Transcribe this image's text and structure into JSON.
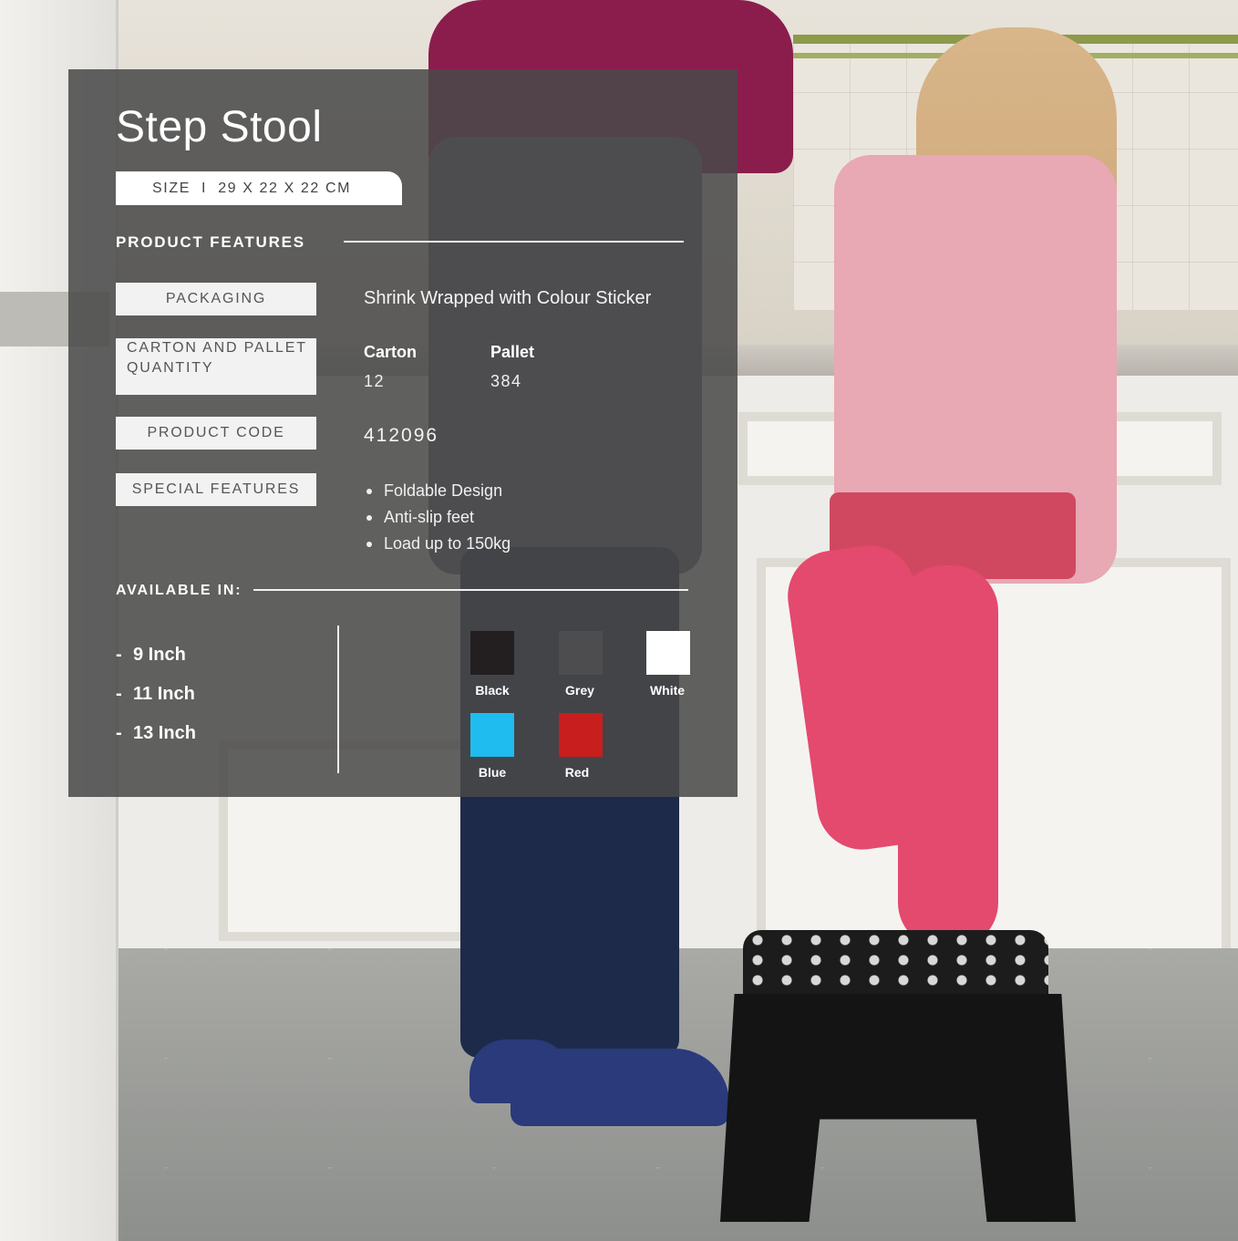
{
  "product": {
    "title": "Step Stool",
    "size": "SIZE  I  29 X 22 X 22 CM"
  },
  "features": {
    "heading": "PRODUCT FEATURES",
    "packaging_label": "PACKAGING",
    "packaging_value": "Shrink Wrapped with Colour Sticker",
    "quantity_label_line1": "CARTON AND PALLET",
    "quantity_label_line2": "QUANTITY",
    "carton_heading": "Carton",
    "carton_value": "12",
    "pallet_heading": "Pallet",
    "pallet_value": "384",
    "code_label": "PRODUCT CODE",
    "code_value": "412096",
    "special_label": "SPECIAL FEATURES",
    "special_items": [
      "Foldable Design",
      "Anti-slip feet",
      "Load up to 150kg"
    ]
  },
  "availability": {
    "heading": "AVAILABLE IN:",
    "sizes": [
      "9 Inch",
      "11 Inch",
      "13 Inch"
    ],
    "colours": [
      {
        "name": "Black",
        "hex": "#231f20"
      },
      {
        "name": "Grey",
        "hex": "#4d4d4f"
      },
      {
        "name": "White",
        "hex": "#ffffff"
      },
      {
        "name": "Blue",
        "hex": "#1fbcef"
      },
      {
        "name": "Red",
        "hex": "#c81e1e"
      }
    ]
  }
}
